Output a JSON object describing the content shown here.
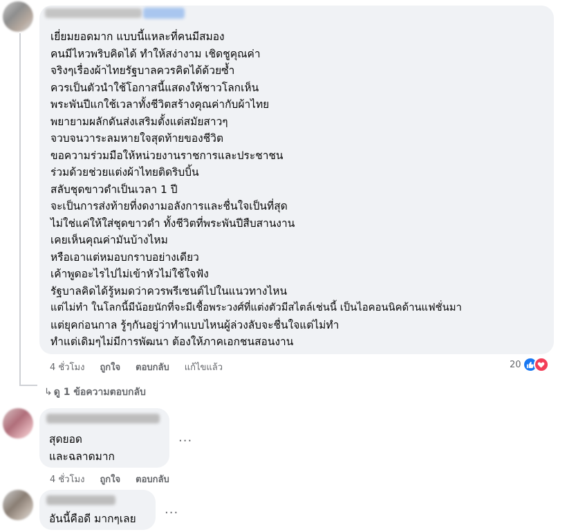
{
  "comments": [
    {
      "lines": [
        "เยี่ยมยอดมาก แบบนี้แหละที่คนมีสมอง",
        "คนมีไหวพริบคิดได้ ทำให้สง่างาม เชิดชูคุณค่า",
        "จริงๆเรื่องผ้าไทยรัฐบาลควรคิดได้ด้วยซ้ำ",
        "ควรเป็นตัวนำใช้โอกาสนี้แสดงให้ชาวโลกเห็น",
        "พระพันปีแกใช้เวลาทั้งชีวิตสร้างคุณค่ากับผ้าไทย",
        "พยายามผลักดันส่งเสริมตั้งแต่สมัยสาวๆ",
        "จวบจนวาระลมหายใจสุดท้ายของชีวิต",
        "ขอความร่วมมือให้หน่วยงานราชการและประชาชน",
        "ร่วมด้วยช่วยแต่งผ้าไทยติดริบบิ้น",
        "สลับชุดขาวดำเป็นเวลา 1 ปี",
        "จะเป็นการส่งท้ายที่งดงามอลังการและชื่นใจเป็นที่สุด",
        "ไม่ใช่แค่ให้ใส่ชุดขาวดำ ทั้งชีวิตที่พระพันปีสืบสานงาน",
        "เคยเห็นคุณค่ามันบ้างไหม",
        "หรือเอาแต่หมอบกราบอย่างเดียว",
        "เค้าพูดอะไรไปไม่เข้าหัวไม่ใช้ใจฟัง",
        "รัฐบาลคิดได้รู้หมดว่าควรพรีเซนต์ไปในแนวทางไหน",
        "แต่ไม่ทำ ในโลกนี้มีน้อยนักที่จะมีเชื้อพระวงศ์ที่แต่งตัวมีสไตล์เช่นนี้ เป็นไอคอนนิคด้านแฟชั่นมา",
        "แต่ยุคก่อนกาล รู้ๆกันอยู่ว่าทำแบบไหนผู้ล่วงลับจะชื่นใจแต่ไม่ทำ",
        "ทำแต่เดิมๆไม่มีการพัฒนา ต้องให้ภาคเอกชนสอนงาน"
      ],
      "meta": {
        "time": "4 ชั่วโมง",
        "like": "ถูกใจ",
        "reply": "ตอบกลับ",
        "edited": "แก้ไขแล้ว"
      },
      "reactions": {
        "count": "20",
        "icons": [
          "like-icon",
          "heart-icon"
        ],
        "colors": {
          "like": "#1877f2",
          "heart": "#f33e58"
        }
      },
      "view_replies": "ดู 1 ข้อความตอบกลับ"
    },
    {
      "lines": [
        "สุดยอด",
        "และฉลาดมาก"
      ],
      "meta": {
        "time": "4 ชั่วโมง",
        "like": "ถูกใจ",
        "reply": "ตอบกลับ"
      },
      "more": "..."
    },
    {
      "lines": [
        "อันนี้คือดี มากๆเลย"
      ],
      "more": "..."
    }
  ]
}
